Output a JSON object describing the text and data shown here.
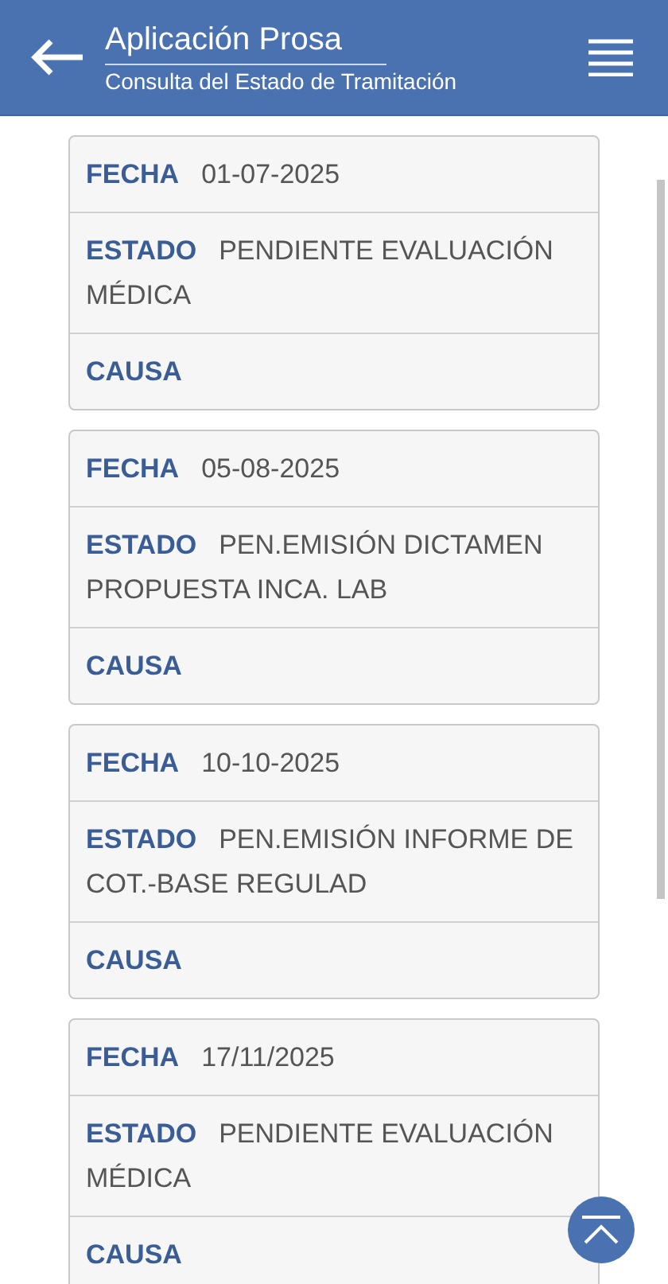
{
  "header": {
    "title": "Aplicación Prosa",
    "subtitle": "Consulta del Estado de Tramitación"
  },
  "records": [
    {
      "fields": [
        {
          "label": "FECHA",
          "value": "01-07-2025"
        },
        {
          "label": "ESTADO",
          "value": "PENDIENTE EVALUACIÓN MÉDICA"
        },
        {
          "label": "CAUSA"
        }
      ]
    },
    {
      "fields": [
        {
          "label": "FECHA",
          "value": "05-08-2025"
        },
        {
          "label": "ESTADO",
          "value": "PEN.EMISIÓN DICTAMEN PROPUESTA INCA. LAB"
        },
        {
          "label": "CAUSA"
        }
      ]
    },
    {
      "fields": [
        {
          "label": "FECHA",
          "value": "10-10-2025"
        },
        {
          "label": "ESTADO",
          "value": "PEN.EMISIÓN INFORME DE COT.-BASE REGULAD"
        },
        {
          "label": "CAUSA"
        }
      ]
    },
    {
      "fields": [
        {
          "label": "FECHA",
          "value": "17/11/2025"
        },
        {
          "label": "ESTADO",
          "value": "PENDIENTE EVALUACIÓN MÉDICA"
        },
        {
          "label": "CAUSA"
        }
      ]
    }
  ]
}
